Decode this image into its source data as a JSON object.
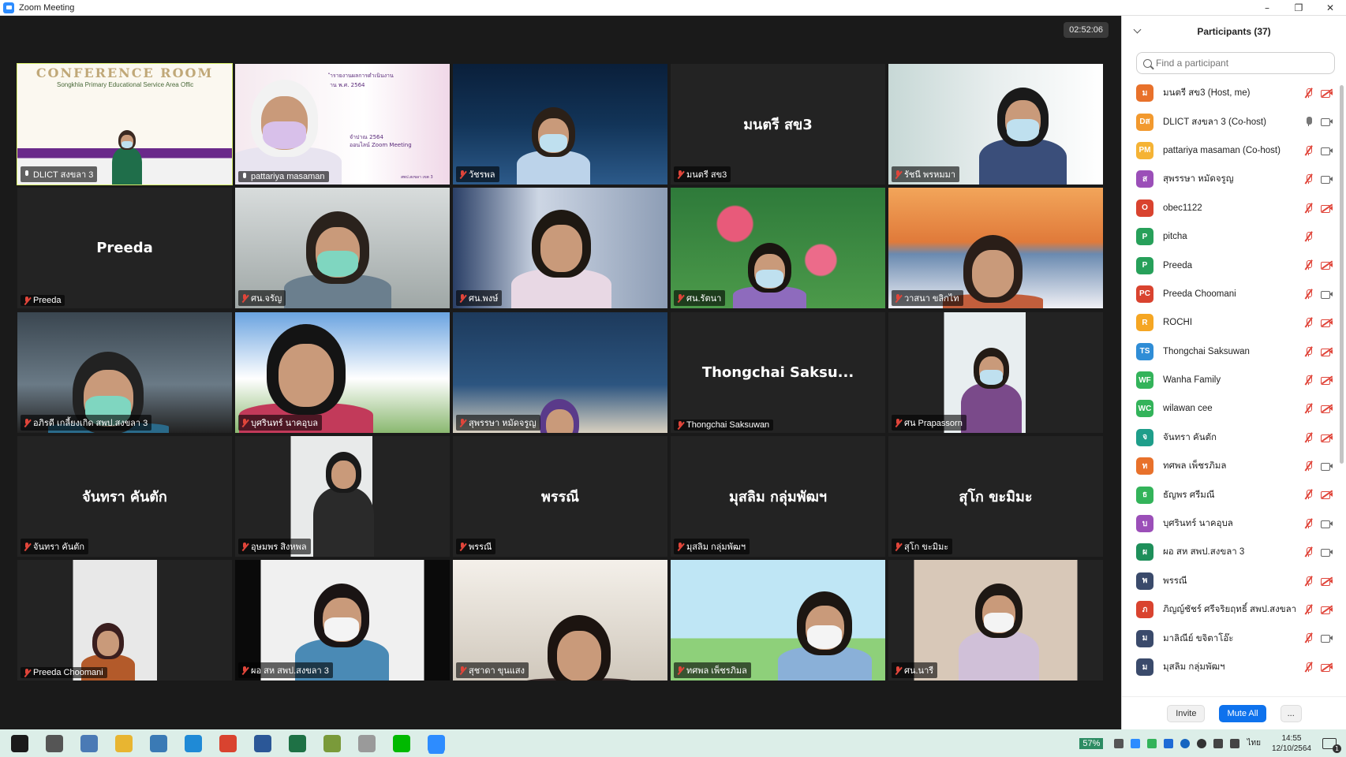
{
  "window": {
    "title": "Zoom Meeting"
  },
  "meeting": {
    "timer": "02:52:06"
  },
  "tiles": [
    {
      "name": "DLICT สงขลา 3",
      "label_prefix": "",
      "active": true
    },
    {
      "name": "pattariya masaman"
    },
    {
      "name": "วัชรพล"
    },
    {
      "name": "มนตรี สข3",
      "big_name": "มนตรี สข3"
    },
    {
      "name": "รัชนี พรหมมา"
    },
    {
      "name": "Preeda",
      "big_name": "Preeda"
    },
    {
      "name": "ศน.จรัญ"
    },
    {
      "name": "ศน.พงษ์"
    },
    {
      "name": "ศน.รัตนา"
    },
    {
      "name": "วาสนา ขลิกไท"
    },
    {
      "name": "อภิรดี เกลี้ยงเกิด สพป.สงขลา 3"
    },
    {
      "name": "บุศรินทร์ นาคอุบล"
    },
    {
      "name": "สุพรรษา หมัดจรูญ"
    },
    {
      "name": "Thongchai Saksuwan",
      "big_name": "Thongchai Saksu..."
    },
    {
      "name": "ศน Prapassorn"
    },
    {
      "name": "จันทรา คันตัก",
      "big_name": "จันทรา คันตัก"
    },
    {
      "name": "อุษมพร สิงหพล"
    },
    {
      "name": "พรรณี",
      "big_name": "พรรณี"
    },
    {
      "name": "มุสลิม กลุ่มพัฒฯ",
      "big_name": "มุสลิม กลุ่มพัฒฯ"
    },
    {
      "name": "สุโก ขะมิมะ",
      "big_name": "สุโก ขะมิมะ"
    },
    {
      "name": "Preeda Choomani"
    },
    {
      "name": "ผอ สห สพป.สงขลา 3"
    },
    {
      "name": "สุชาดา ขุนแสง"
    },
    {
      "name": "ทศพล เพ็ชรภิมล"
    },
    {
      "name": "ศน.นารี"
    }
  ],
  "tile_banner": {
    "conference_title": "CONFERENCE ROOM",
    "conference_sub": "Songkhla Primary Educational Service Area Offic",
    "slide_year": "าน พ.ศ. 2564",
    "slide_title": "ำรายงานผลการดำเนินงาน",
    "slide_online": "ออนไลน์ Zoom Meeting",
    "slide_2564": "จำปาณ 2564",
    "slide_footer": "สพป.สงขลา เขต 3"
  },
  "participants_panel": {
    "title": "Participants (37)",
    "search_placeholder": "Find a participant",
    "invite_label": "Invite",
    "mute_all_label": "Mute All",
    "more_label": "...",
    "items": [
      {
        "initials": "ม",
        "name": "มนตรี สข3 (Host, me)",
        "color": "#e8712b",
        "mic": "off",
        "video": "off"
      },
      {
        "initials": "Dส",
        "name": "DLICT สงขลา 3 (Co-host)",
        "color": "#f2992e",
        "mic": "on",
        "video": "on"
      },
      {
        "initials": "PM",
        "name": "pattariya masaman (Co-host)",
        "color": "#f5b335",
        "mic": "off",
        "video": "on"
      },
      {
        "initials": "ส",
        "name": "สุพรรษา หมัดจรูญ",
        "color": "#9b4fb8",
        "mic": "off",
        "video": "on"
      },
      {
        "initials": "O",
        "name": "obec1122",
        "color": "#d9432f",
        "mic": "off",
        "video": "off"
      },
      {
        "initials": "P",
        "name": "pitcha",
        "color": "#27a05a",
        "mic": "off",
        "video": "none"
      },
      {
        "initials": "P",
        "name": "Preeda",
        "color": "#27a05a",
        "mic": "off",
        "video": "off"
      },
      {
        "initials": "PC",
        "name": "Preeda Choomani",
        "color": "#d9432f",
        "mic": "off",
        "video": "on"
      },
      {
        "initials": "R",
        "name": "ROCHI",
        "color": "#f5a623",
        "mic": "off",
        "video": "off"
      },
      {
        "initials": "TS",
        "name": "Thongchai Saksuwan",
        "color": "#2f8dd6",
        "mic": "off",
        "video": "off"
      },
      {
        "initials": "WF",
        "name": "Wanha Family",
        "color": "#33b35a",
        "mic": "off",
        "video": "off"
      },
      {
        "initials": "WC",
        "name": "wilawan cee",
        "color": "#33b35a",
        "mic": "off",
        "video": "off"
      },
      {
        "initials": "จ",
        "name": "จันทรา คันตัก",
        "color": "#1e9e8a",
        "mic": "off",
        "video": "off"
      },
      {
        "initials": "ท",
        "name": "ทศพล เพ็ชรภิมล",
        "color": "#e8712b",
        "mic": "off",
        "video": "on"
      },
      {
        "initials": "ธ",
        "name": "ธัญพร ศรีมณี",
        "color": "#33b35a",
        "mic": "off",
        "video": "off"
      },
      {
        "initials": "บ",
        "name": "บุศรินทร์ นาคอุบล",
        "color": "#9b4fb8",
        "mic": "off",
        "video": "on"
      },
      {
        "initials": "ผ",
        "name": "ผอ สห สพป.สงขลา 3",
        "color": "#1e8f5a",
        "mic": "off",
        "video": "on"
      },
      {
        "initials": "พ",
        "name": "พรรณี",
        "color": "#3a4a6b",
        "mic": "off",
        "video": "off"
      },
      {
        "initials": "ภ",
        "name": "ภิญญ์ชัชร์ ศรีจริยฤทธิ์ สพป.สงขลา เขต...",
        "color": "#d9432f",
        "mic": "off",
        "video": "off"
      },
      {
        "initials": "ม",
        "name": "มาลิณีย์ ขจิตาโอ๊ะ",
        "color": "#3a4a6b",
        "mic": "off",
        "video": "on"
      },
      {
        "initials": "ม",
        "name": "มุสลิม กลุ่มพัฒฯ",
        "color": "#3a4a6b",
        "mic": "off",
        "video": "off"
      }
    ]
  },
  "taskbar": {
    "battery": "57%",
    "time": "14:55",
    "date": "12/10/2564",
    "lang": "ไทย",
    "notif_count": "1",
    "apps": [
      "start-icon",
      "settings-icon",
      "store-icon",
      "explorer-icon",
      "photos-icon",
      "edge-icon",
      "chrome-icon",
      "word-icon",
      "excel-icon",
      "notepad-icon",
      "app-icon",
      "line-icon",
      "zoom-icon"
    ]
  }
}
